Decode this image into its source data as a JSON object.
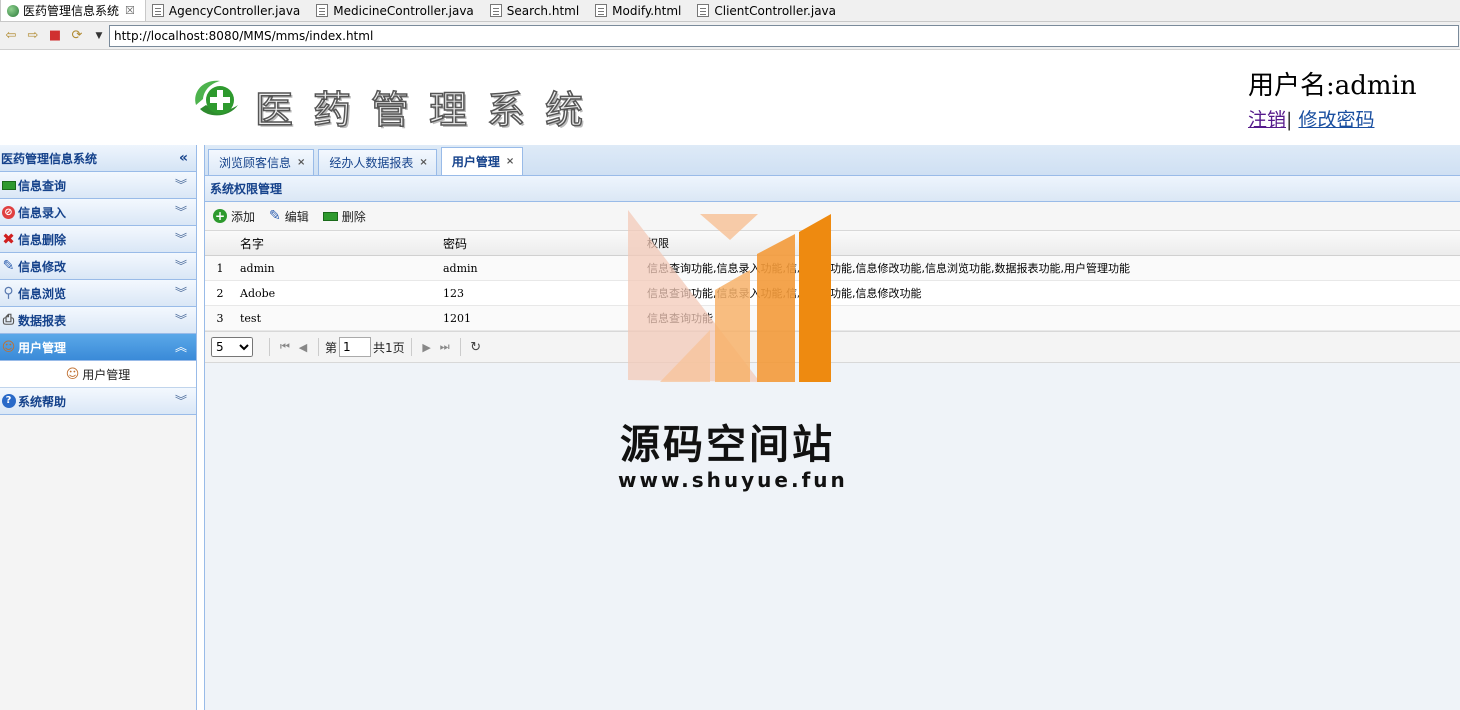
{
  "editor_tabs": [
    {
      "label": "医药管理信息系统",
      "active": true,
      "close": "☒"
    },
    {
      "label": "AgencyController.java"
    },
    {
      "label": "MedicineController.java"
    },
    {
      "label": "Search.html"
    },
    {
      "label": "Modify.html"
    },
    {
      "label": "ClientController.java"
    }
  ],
  "browser": {
    "url": "http://localhost:8080/MMS/mms/index.html"
  },
  "header": {
    "title": "医药管理系统",
    "username": "用户名:admin",
    "logout": "注销",
    "separator": "|",
    "change_password": "修改密码"
  },
  "sidebar": {
    "title": "医药管理信息系统",
    "items": [
      {
        "label": "信息查询",
        "icon": "green-bar-icon"
      },
      {
        "label": "信息录入",
        "icon": "no-entry-icon"
      },
      {
        "label": "信息删除",
        "icon": "red-x-icon"
      },
      {
        "label": "信息修改",
        "icon": "pencil-icon"
      },
      {
        "label": "信息浏览",
        "icon": "magnifier-icon"
      },
      {
        "label": "数据报表",
        "icon": "printer-icon"
      },
      {
        "label": "用户管理",
        "icon": "user-icon",
        "active": true
      },
      {
        "label": "系统帮助",
        "icon": "help-icon"
      }
    ],
    "sub_item": "用户管理"
  },
  "tabs": [
    {
      "label": "浏览顾客信息"
    },
    {
      "label": "经办人数据报表"
    },
    {
      "label": "用户管理",
      "active": true
    }
  ],
  "panel": {
    "title": "系统权限管理",
    "toolbar": {
      "add": "添加",
      "edit": "编辑",
      "delete": "删除"
    },
    "columns": [
      "名字",
      "密码",
      "权限"
    ],
    "rows": [
      {
        "num": "1",
        "name": "admin",
        "password": "admin",
        "permissions": "信息查询功能,信息录入功能,信息删除功能,信息修改功能,信息浏览功能,数据报表功能,用户管理功能"
      },
      {
        "num": "2",
        "name": "Adobe",
        "password": "123",
        "permissions": "信息查询功能,信息录入功能,信息删除功能,信息修改功能"
      },
      {
        "num": "3",
        "name": "test",
        "password": "1201",
        "permissions": "信息查询功能"
      }
    ],
    "pager": {
      "page_size": "5",
      "page_prefix": "第",
      "page_value": "1",
      "page_total": "共1页"
    }
  },
  "watermark": {
    "name": "源码空间站",
    "url": "www.shuyue.fun",
    "colors": [
      "#f3c9b8",
      "#f7b16a",
      "#f39a3a",
      "#ee8a10"
    ]
  }
}
